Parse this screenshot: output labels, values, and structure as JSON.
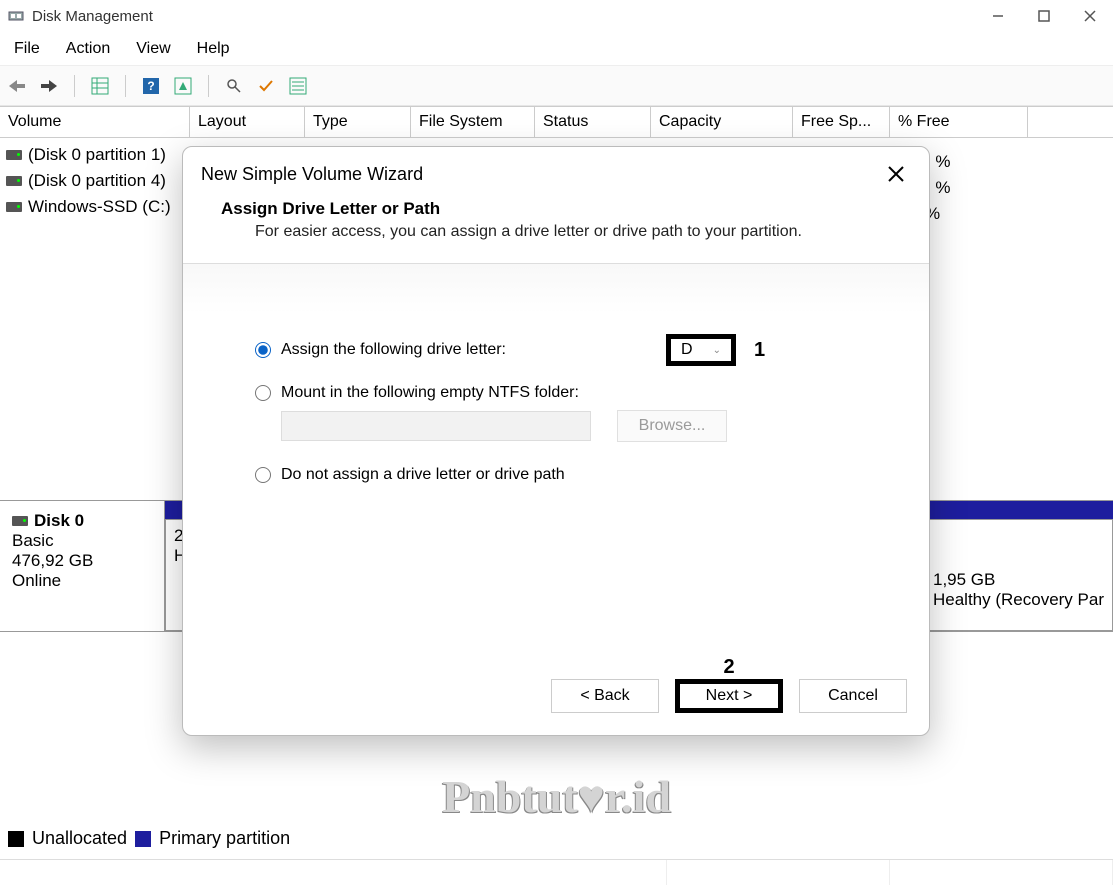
{
  "window": {
    "title": "Disk Management"
  },
  "menu": {
    "file": "File",
    "action": "Action",
    "view": "View",
    "help": "Help"
  },
  "columns": {
    "volume": "Volume",
    "layout": "Layout",
    "type": "Type",
    "filesystem": "File System",
    "status": "Status",
    "capacity": "Capacity",
    "freespace": "Free Sp...",
    "pctfree": "% Free"
  },
  "volumes": {
    "r0": {
      "name": "(Disk 0 partition 1)",
      "pctfree": ") %"
    },
    "r1": {
      "name": "(Disk 0 partition 4)",
      "pctfree": ") %"
    },
    "r2": {
      "name": "Windows-SSD (C:)",
      "pctfree": " %"
    }
  },
  "disk": {
    "label": "Disk 0",
    "type": "Basic",
    "capacity": "476,92 GB",
    "status": "Online",
    "part_left": "2",
    "part_left2": "H",
    "part_right_size": "1,95 GB",
    "part_right_status": "Healthy (Recovery Par"
  },
  "legend": {
    "unalloc": "Unallocated",
    "primary": "Primary partition"
  },
  "watermark": "Pnbtut♥r.id",
  "wizard": {
    "title": "New Simple Volume Wizard",
    "head_title": "Assign Drive Letter or Path",
    "head_sub": "For easier access, you can assign a drive letter or drive path to your partition.",
    "opt_assign": "Assign the following drive letter:",
    "drive_letter": "D",
    "opt_mount": "Mount in the following empty NTFS folder:",
    "browse": "Browse...",
    "opt_none": "Do not assign a drive letter or drive path",
    "back": "< Back",
    "next": "Next >",
    "cancel": "Cancel",
    "annot1": "1",
    "annot2": "2"
  }
}
